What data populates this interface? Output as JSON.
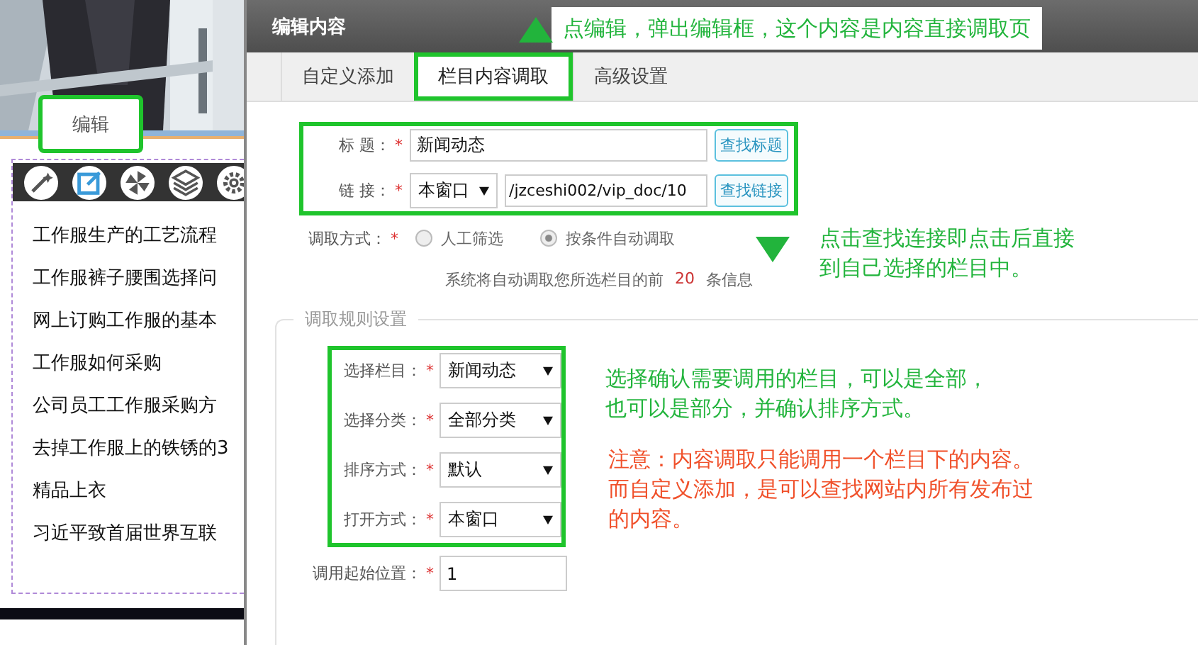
{
  "page": {
    "edit_button": "编辑",
    "list_items": [
      "工作服生产的工艺流程",
      "工作服裤子腰围选择问",
      "网上订购工作服的基本",
      "工作服如何采购",
      "公司员工工作服采购方",
      "去掉工作服上的铁锈的3",
      "精品上衣",
      "习近平致首届世界互联"
    ]
  },
  "dialog": {
    "title": "编辑内容",
    "tabs": [
      {
        "label": "自定义添加",
        "selected": false,
        "highlighted": false
      },
      {
        "label": "栏目内容调取",
        "selected": true,
        "highlighted": true
      },
      {
        "label": "高级设置",
        "selected": false,
        "highlighted": false
      }
    ],
    "title_field": {
      "label": "标 题：",
      "value": "新闻动态",
      "button": "查找标题"
    },
    "link_field": {
      "label": "链 接：",
      "target": "本窗口",
      "value": "/jzceshi002/vip_doc/10",
      "button": "查找链接"
    },
    "method": {
      "label": "调取方式：",
      "options": [
        {
          "label": "人工筛选",
          "selected": false
        },
        {
          "label": "按条件自动调取",
          "selected": true
        }
      ]
    },
    "info": {
      "before": "系统将自动调取您所选栏目的前",
      "count": "20",
      "after": "条信息"
    },
    "rules": {
      "legend": "调取规则设置",
      "selects": [
        {
          "label": "选择栏目：",
          "value": "新闻动态"
        },
        {
          "label": "选择分类：",
          "value": "全部分类"
        },
        {
          "label": "排序方式：",
          "value": "默认"
        },
        {
          "label": "打开方式：",
          "value": "本窗口"
        }
      ],
      "start": {
        "label": "调用起始位置：",
        "value": "1"
      }
    }
  },
  "required_marks": [
    "*",
    "*",
    "*",
    "*",
    "*",
    "*",
    "*",
    "*"
  ],
  "annotations": [
    {
      "kind": "top",
      "lines": [
        "点编辑，弹出编辑框，这个内容是内容直接调取页"
      ],
      "color": "#22b43c"
    },
    {
      "kind": "link",
      "lines": [
        "点击查找连接即点击后直接",
        "到自己选择的栏目中。"
      ],
      "color": "#22b43c"
    },
    {
      "kind": "rules",
      "lines": [
        "选择确认需要调用的栏目，可以是全部，",
        "也可以是部分，并确认排序方式。"
      ],
      "color": "#22b43c"
    },
    {
      "kind": "note",
      "lines": [
        "注意：内容调取只能调用一个栏目下的内容。",
        "而自定义添加，是可以查找网站内所有发布过",
        "的内容。"
      ],
      "color": "#f0502a"
    }
  ]
}
